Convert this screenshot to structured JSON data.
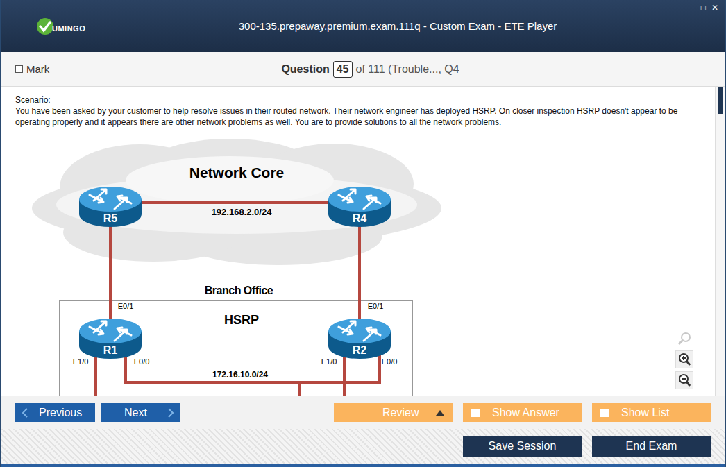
{
  "window": {
    "title": "300-135.prepaway.premium.exam.111q - Custom Exam - ETE Player",
    "controls": [
      "_",
      "□",
      "✕"
    ]
  },
  "logo": {
    "text": "UMINGO"
  },
  "question_bar": {
    "mark": {
      "label": "Mark",
      "checked": false
    },
    "label": "Question",
    "number": "45",
    "of": "of 111 (Trouble..., Q4"
  },
  "scenario": {
    "heading": "Scenario:",
    "text": "You have been asked by your customer to help resolve issues in their routed network. Their network engineer has deployed HSRP. On closer inspection HSRP doesn't appear to be operating properly and it appears there are other network problems as well. You are to provide solutions to all the network problems."
  },
  "diagram": {
    "core_label": "Network Core",
    "core_subnet": "192.168.2.0/24",
    "branch_label": "Branch Office",
    "hsrp_label": "HSRP",
    "lan_subnet": "172.16.10.0/24",
    "routers": [
      {
        "name": "R5",
        "interfaces": []
      },
      {
        "name": "R4",
        "interfaces": []
      },
      {
        "name": "R1",
        "interfaces": [
          "E0/1",
          "E1/0",
          "E0/0"
        ]
      },
      {
        "name": "R2",
        "interfaces": [
          "E0/1",
          "E1/0",
          "E0/0"
        ]
      }
    ]
  },
  "zoom": {
    "reset_disabled": true
  },
  "nav": {
    "previous": "Previous",
    "next": "Next"
  },
  "review": {
    "label": "Review"
  },
  "toggles": [
    {
      "label": "Show Answer",
      "checked": false
    },
    {
      "label": "Show List",
      "checked": false
    }
  ],
  "actions": [
    "Save Session",
    "End Exam"
  ]
}
